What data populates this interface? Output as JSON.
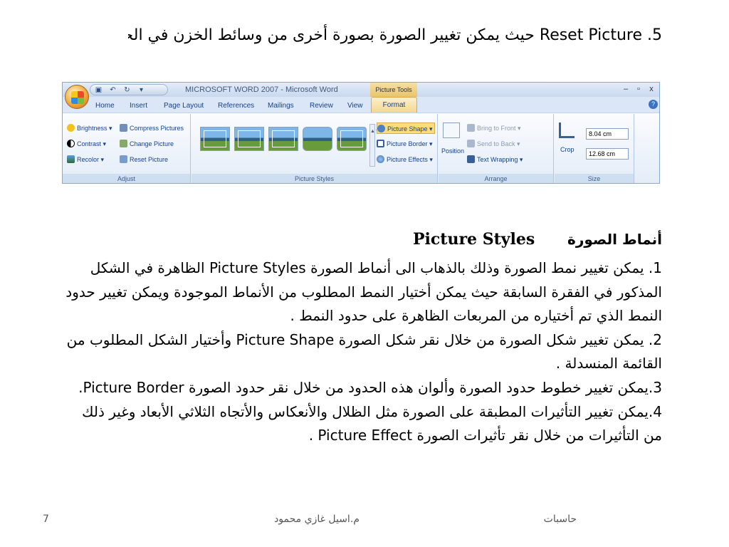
{
  "top_line": "5. Reset Picture  حيث يمكن تغيير الصورة بصورة أخرى من وسائط الخزن في الحاسبة.",
  "ribbon": {
    "window_title": "MICROSOFT WORD 2007 - Microsoft Word",
    "contextual_title": "Picture Tools",
    "window_controls": [
      "–",
      "▫",
      "x"
    ],
    "tabs": [
      "Home",
      "Insert",
      "Page Layout",
      "References",
      "Mailings",
      "Review",
      "View"
    ],
    "active_tab": "Format",
    "adjust": {
      "brightness": "Brightness ▾",
      "contrast": "Contrast ▾",
      "recolor": "Recolor ▾",
      "compress": "Compress Pictures",
      "change": "Change Picture",
      "reset": "Reset Picture",
      "label": "Adjust"
    },
    "styles": {
      "picture_shape": "Picture Shape ▾",
      "picture_border": "Picture Border ▾",
      "picture_effects": "Picture Effects ▾",
      "label": "Picture Styles"
    },
    "arrange": {
      "position": "Position",
      "bring_to_front": "Bring to Front ▾",
      "send_to_back": "Send to Back ▾",
      "text_wrapping": "Text Wrapping ▾",
      "label": "Arrange"
    },
    "size": {
      "crop": "Crop",
      "height_value": "8.04 cm",
      "width_value": "12.68 cm",
      "label": "Size"
    }
  },
  "heading": {
    "arabic": "أنماط الصورة",
    "english": "Picture Styles"
  },
  "paragraphs": [
    "1.   يمكن تغيير نمط الصورة وذلك بالذهاب الى أنماط الصورة Picture Styles الظاهرة في الشكل المذكور في الفقرة السابقة  حيث يمكن أختيار النمط المطلوب من الأنماط الموجودة ويمكن تغيير حدود النمط الذي تم أختياره من المربعات الظاهرة على حدود النمط .",
    "2.  يمكن تغيير شكل الصورة من خلال نقر شكل الصورة   Picture Shape وأختيار الشكل المطلوب من القائمة المنسدلة .",
    "3.يمكن تغيير خطوط حدود الصورة وألوان هذه الحدود من خلال نقر حدود الصورة  Picture Border.",
    "4.يمكن تغيير التأثيرات المطبقة على الصورة مثل الظلال والأنعكاس والأتجاه الثلاثي الأبعاد وغير ذلك من التأثيرات من خلال نقر تأثيرات الصورة   Picture Effect  ."
  ],
  "footer": {
    "subject": "حاسبات",
    "author": "م.اسيل غازي محمود",
    "page": "7"
  }
}
